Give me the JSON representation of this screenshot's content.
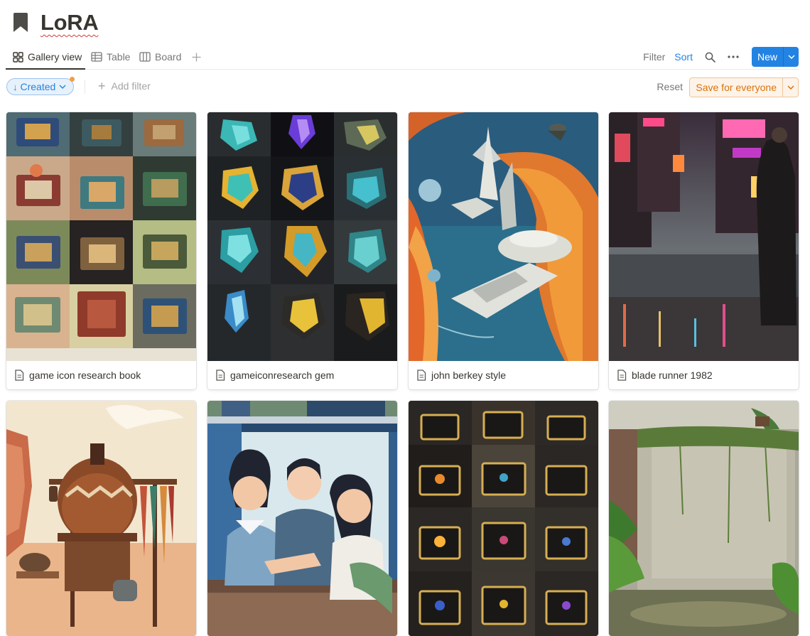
{
  "page": {
    "title": "LoRA",
    "icon": "bookmark-icon"
  },
  "views": {
    "tabs": [
      {
        "label": "Gallery view",
        "icon": "gallery-grid-icon",
        "active": true
      },
      {
        "label": "Table",
        "icon": "table-icon",
        "active": false
      },
      {
        "label": "Board",
        "icon": "board-icon",
        "active": false
      }
    ]
  },
  "toolbar": {
    "filter_label": "Filter",
    "sort_label": "Sort",
    "new_label": "New"
  },
  "filter_bar": {
    "sort_pill_label": "Created",
    "add_filter_label": "Add filter",
    "reset_label": "Reset",
    "save_label": "Save for everyone"
  },
  "colors": {
    "accent": "#2383e2",
    "save_orange": "#d9730d",
    "save_bg": "#fdf3e8",
    "text": "#37352f",
    "muted": "#787774"
  },
  "gallery": {
    "cards": [
      {
        "title": "game icon research book",
        "cover": "icon grid of illustrated books"
      },
      {
        "title": "gameiconresearch gem",
        "cover": "icon grid of glowing gems"
      },
      {
        "title": "john berkey style",
        "cover": "space cruisers over an orange planet"
      },
      {
        "title": "blade runner 1982",
        "cover": "rainy neon city street"
      },
      {
        "title": "",
        "cover": "desert pot with feathers"
      },
      {
        "title": "",
        "cover": "flat illustration of three people"
      },
      {
        "title": "",
        "cover": "icon grid of treasure chests"
      },
      {
        "title": "",
        "cover": "mossy concrete wall with plants"
      }
    ]
  }
}
